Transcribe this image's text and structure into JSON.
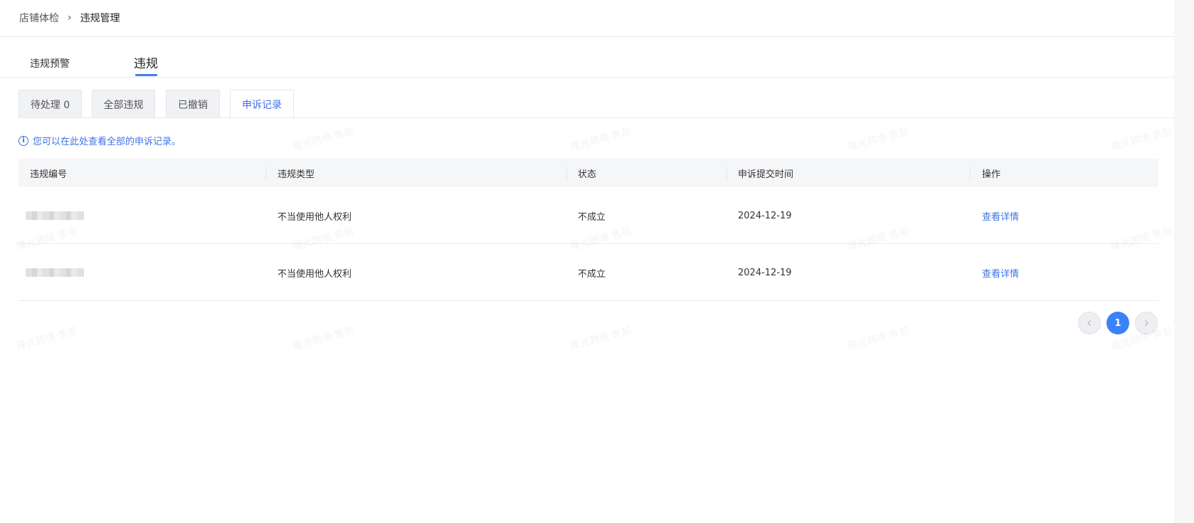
{
  "breadcrumb": {
    "parent": "店铺体检",
    "separator": "›",
    "current": "违规管理"
  },
  "top_tabs": [
    {
      "label": "违规预警"
    },
    {
      "label": "违规"
    }
  ],
  "sub_tabs": [
    {
      "label": "待处理 0"
    },
    {
      "label": "全部违规"
    },
    {
      "label": "已撤销"
    },
    {
      "label": "申诉记录",
      "active": true
    }
  ],
  "info": {
    "icon": "info-icon",
    "text": "您可以在此处查看全部的申诉记录。"
  },
  "table": {
    "columns": [
      "违规编号",
      "违规类型",
      "状态",
      "申诉提交时间",
      "操作"
    ],
    "rows": [
      {
        "id": "",
        "type": "不当使用他人权利",
        "status": "不成立",
        "time": "2024-12-19",
        "action": "查看详情"
      },
      {
        "id": "",
        "type": "不当使用他人权利",
        "status": "不成立",
        "time": "2024-12-19",
        "action": "查看详情"
      }
    ]
  },
  "pagination": {
    "prev_icon": "chevron-left-icon",
    "current_page": "1",
    "next_icon": "chevron-right-icon"
  },
  "watermark": "隆光跨境·售前",
  "colors": {
    "accent": "#3f73e6",
    "pager_active": "#3a82f7",
    "header_bg": "#f5f6f8"
  }
}
